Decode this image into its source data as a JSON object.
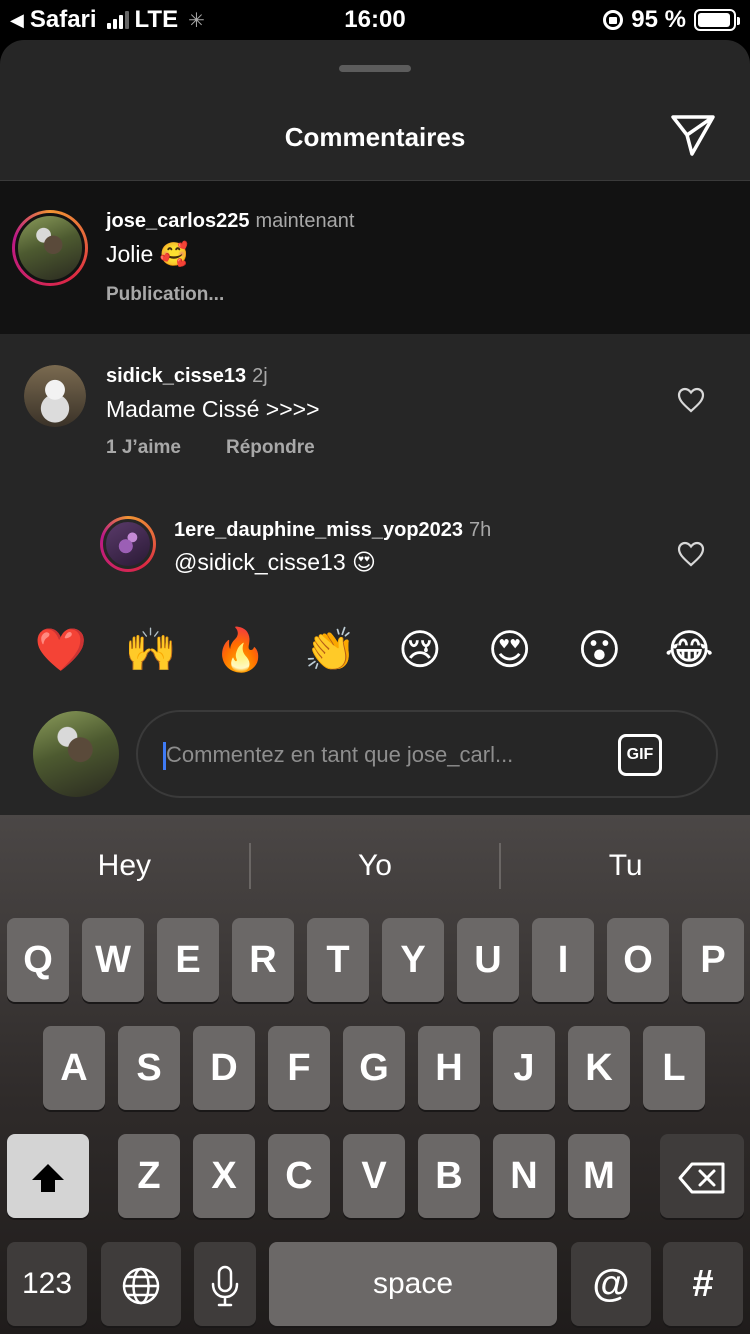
{
  "status_bar": {
    "back_app": "Safari",
    "network": "LTE",
    "time": "16:00",
    "battery": "95 %",
    "battery_level": 0.95
  },
  "sheet": {
    "title": "Commentaires"
  },
  "comments": [
    {
      "username": "jose_carlos225",
      "time": "maintenant",
      "text": "Jolie 🥰",
      "status": "Publication..."
    },
    {
      "username": "sidick_cisse13",
      "time": "2j",
      "text": "Madame Cissé >>>>",
      "likes": "1 J’aime",
      "reply_label": "Répondre"
    },
    {
      "username": "1ere_dauphine_miss_yop2023",
      "time": "7h",
      "text": "@sidick_cisse13 😍"
    }
  ],
  "emoji_bar": [
    "❤️",
    "🙌",
    "🔥",
    "👏",
    "😢",
    "😍",
    "😮",
    "😂"
  ],
  "composer": {
    "placeholder": "Commentez en tant que jose_carl...",
    "gif_label": "GIF"
  },
  "keyboard": {
    "suggestions": [
      "Hey",
      "Yo",
      "Tu"
    ],
    "row1": [
      "Q",
      "W",
      "E",
      "R",
      "T",
      "Y",
      "U",
      "I",
      "O",
      "P"
    ],
    "row2": [
      "A",
      "S",
      "D",
      "F",
      "G",
      "H",
      "J",
      "K",
      "L"
    ],
    "row3": [
      "Z",
      "X",
      "C",
      "V",
      "B",
      "N",
      "M"
    ],
    "numbers_label": "123",
    "space_label": "space",
    "at_label": "@",
    "hash_label": "#"
  }
}
